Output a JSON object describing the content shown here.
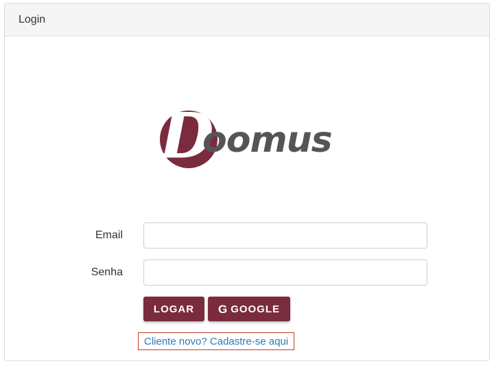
{
  "header": {
    "title": "Login"
  },
  "brand": {
    "logo_text": "Doomus",
    "colors": {
      "accent": "#7a2c3e",
      "text": "#555555"
    }
  },
  "form": {
    "email_label": "Email",
    "email_value": "",
    "password_label": "Senha",
    "password_value": ""
  },
  "buttons": {
    "login_label": "LOGAR",
    "google_label": "GOOGLE",
    "google_icon": "google-g-icon"
  },
  "register": {
    "link_text": "Cliente novo? Cadastre-se aqui"
  },
  "colors": {
    "button_bg": "#7a2c3e",
    "link": "#2a7ab8",
    "link_border": "#c0392b"
  }
}
